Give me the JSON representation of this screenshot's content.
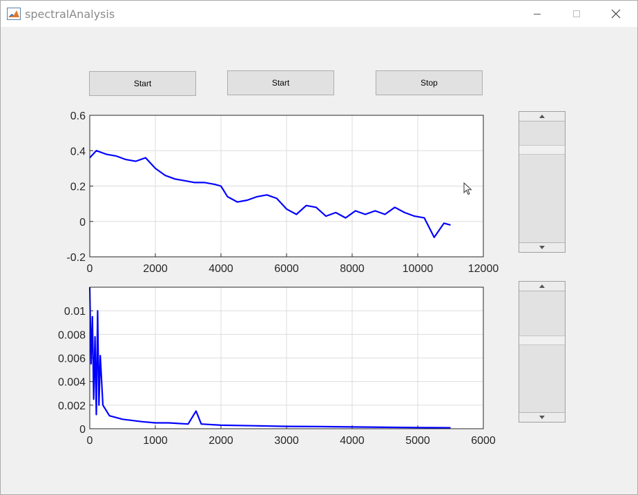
{
  "window": {
    "title": "spectralAnalysis",
    "icon": "matlab-membrane-icon",
    "controls": [
      "minimize-icon",
      "maximize-icon",
      "close-icon"
    ]
  },
  "buttons": [
    {
      "label": "Start"
    },
    {
      "label": "Start"
    },
    {
      "label": "Stop"
    }
  ],
  "chart_data": [
    {
      "type": "line",
      "title": "",
      "xlabel": "",
      "ylabel": "",
      "xlim": [
        0,
        12000
      ],
      "ylim": [
        -0.2,
        0.6
      ],
      "xticks": [
        "0",
        "2000",
        "4000",
        "6000",
        "8000",
        "10000",
        "12000"
      ],
      "yticks": [
        "-0.2",
        "0",
        "0.2",
        "0.4",
        "0.6"
      ],
      "grid": true,
      "series": [
        {
          "color": "#0000ff",
          "x": [
            0,
            200,
            500,
            800,
            1100,
            1400,
            1700,
            2000,
            2300,
            2600,
            2900,
            3200,
            3500,
            3800,
            4000,
            4200,
            4500,
            4800,
            5100,
            5400,
            5700,
            6000,
            6300,
            6600,
            6900,
            7200,
            7500,
            7800,
            8100,
            8400,
            8700,
            9000,
            9300,
            9600,
            9900,
            10200,
            10500,
            10800,
            11000
          ],
          "y": [
            0.36,
            0.4,
            0.38,
            0.37,
            0.35,
            0.34,
            0.36,
            0.3,
            0.26,
            0.24,
            0.23,
            0.22,
            0.22,
            0.21,
            0.2,
            0.14,
            0.11,
            0.12,
            0.14,
            0.15,
            0.13,
            0.07,
            0.04,
            0.09,
            0.08,
            0.03,
            0.05,
            0.02,
            0.06,
            0.04,
            0.06,
            0.04,
            0.08,
            0.05,
            0.03,
            0.02,
            -0.09,
            -0.01,
            -0.02
          ]
        }
      ]
    },
    {
      "type": "line",
      "title": "",
      "xlabel": "",
      "ylabel": "",
      "xlim": [
        0,
        6000
      ],
      "ylim": [
        0,
        0.012
      ],
      "xticks": [
        "0",
        "1000",
        "2000",
        "3000",
        "4000",
        "5000",
        "6000"
      ],
      "yticks": [
        "0",
        "0.002",
        "0.004",
        "0.006",
        "0.008",
        "0.01"
      ],
      "grid": true,
      "series": [
        {
          "color": "#0000ff",
          "x": [
            0,
            20,
            40,
            60,
            80,
            100,
            120,
            140,
            160,
            200,
            300,
            500,
            800,
            1000,
            1200,
            1500,
            1620,
            1700,
            2000,
            2500,
            3000,
            3500,
            4000,
            4500,
            5000,
            5500
          ],
          "y": [
            0.012,
            0.0055,
            0.0095,
            0.0025,
            0.0078,
            0.0012,
            0.01,
            0.002,
            0.0062,
            0.002,
            0.0011,
            0.0008,
            0.0006,
            0.0005,
            0.0005,
            0.0004,
            0.0015,
            0.0004,
            0.0003,
            0.00025,
            0.0002,
            0.00018,
            0.00015,
            0.00012,
            0.0001,
            8e-05
          ]
        }
      ]
    }
  ],
  "scrollbars": [
    {
      "name": "scroll-upper",
      "up_arrow": "scroll-up-arrow-icon",
      "down_arrow": "scroll-down-arrow-icon"
    },
    {
      "name": "scroll-lower",
      "up_arrow": "scroll-up-arrow-icon",
      "down_arrow": "scroll-down-arrow-icon"
    }
  ]
}
